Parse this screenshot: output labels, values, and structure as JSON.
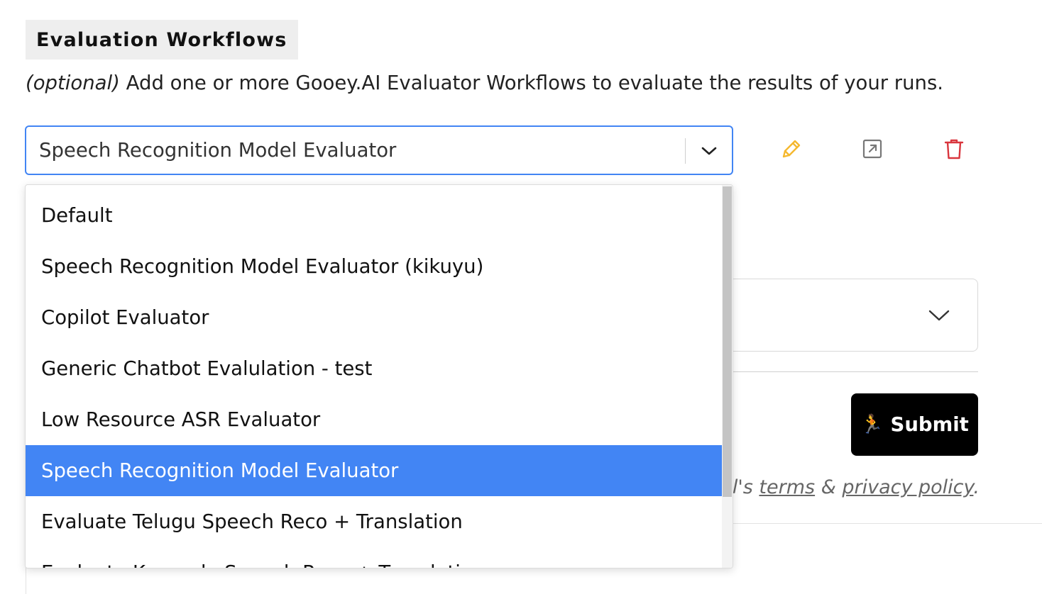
{
  "section": {
    "title": "Evaluation Workflows",
    "description_prefix": "(optional)",
    "description": "Add one or more Gooey.AI Evaluator Workflows to evaluate the results of your runs."
  },
  "select": {
    "value": "Speech Recognition Model Evaluator",
    "options": [
      "Default",
      "Speech Recognition Model Evaluator (kikuyu)",
      "Copilot Evaluator",
      "Generic Chatbot Evalulation - test",
      "Low Resource ASR Evaluator",
      "Speech Recognition Model Evaluator",
      "Evaluate Telugu Speech Reco + Translation",
      "Evaluate Kannada Speech Reco + Translation"
    ],
    "selected_index": 5
  },
  "actions": {
    "edit_icon": "pencil-icon",
    "open_icon": "external-link-icon",
    "delete_icon": "trash-icon",
    "edit_color": "#f5b82e",
    "open_color": "#777777",
    "delete_color": "#d9363e"
  },
  "form": {
    "submit_label": "Submit",
    "terms_prefix": "al's",
    "terms_link": "terms",
    "terms_and": "&",
    "privacy_link": "privacy policy",
    "terms_suffix": "."
  },
  "colors": {
    "accent": "#4285f4",
    "submit_bg": "#000000"
  }
}
